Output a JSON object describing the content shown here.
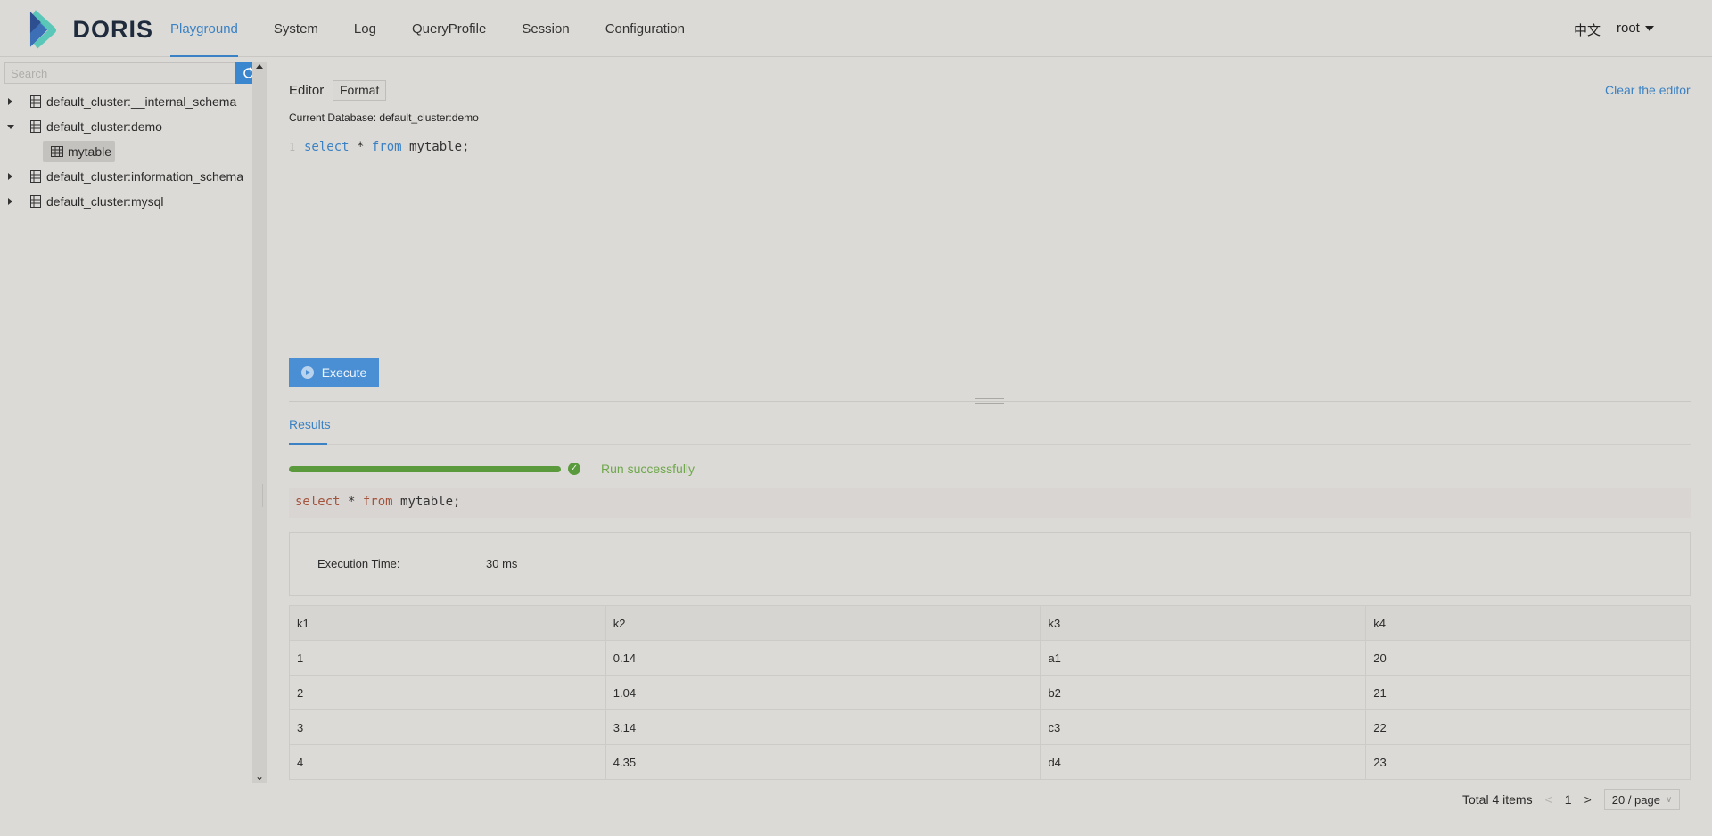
{
  "app": {
    "logo_text": "DORIS"
  },
  "nav": {
    "items": [
      {
        "label": "Playground"
      },
      {
        "label": "System"
      },
      {
        "label": "Log"
      },
      {
        "label": "QueryProfile"
      },
      {
        "label": "Session"
      },
      {
        "label": "Configuration"
      }
    ],
    "active": "Playground",
    "language": "中文",
    "user": "root"
  },
  "sidebar": {
    "search_placeholder": "Search",
    "tree": [
      {
        "label": "default_cluster:__internal_schema",
        "expanded": false
      },
      {
        "label": "default_cluster:demo",
        "expanded": true,
        "children": [
          {
            "label": "mytable"
          }
        ]
      },
      {
        "label": "default_cluster:information_schema",
        "expanded": false
      },
      {
        "label": "default_cluster:mysql",
        "expanded": false
      }
    ]
  },
  "editor": {
    "tab_label": "Editor",
    "format_label": "Format",
    "clear_label": "Clear the editor",
    "current_database": "Current Database: default_cluster:demo",
    "line_number": "1",
    "code": {
      "kw1": "select",
      "mid": " * ",
      "kw2": "from",
      "rest": " mytable;"
    },
    "execute_label": "Execute"
  },
  "results": {
    "tab_label": "Results",
    "progress": 1.0,
    "status": "Run successfully",
    "sql": {
      "kw1": "select",
      "mid": " * ",
      "kw2": "from",
      "rest": " mytable;"
    },
    "execution_time_label": "Execution Time:",
    "execution_time_value": "30 ms",
    "columns": [
      "k1",
      "k2",
      "k3",
      "k4"
    ],
    "rows": [
      [
        "1",
        "0.14",
        "a1",
        "20"
      ],
      [
        "2",
        "1.04",
        "b2",
        "21"
      ],
      [
        "3",
        "3.14",
        "c3",
        "22"
      ],
      [
        "4",
        "4.35",
        "d4",
        "23"
      ]
    ],
    "pagination": {
      "total": "Total 4 items",
      "current_page": "1",
      "page_size": "20 / page"
    }
  },
  "colors": {
    "accent": "#3b82c4",
    "success": "#5a9a3c",
    "execute_button": "#4a8fd3",
    "background": "#dcdad6"
  }
}
